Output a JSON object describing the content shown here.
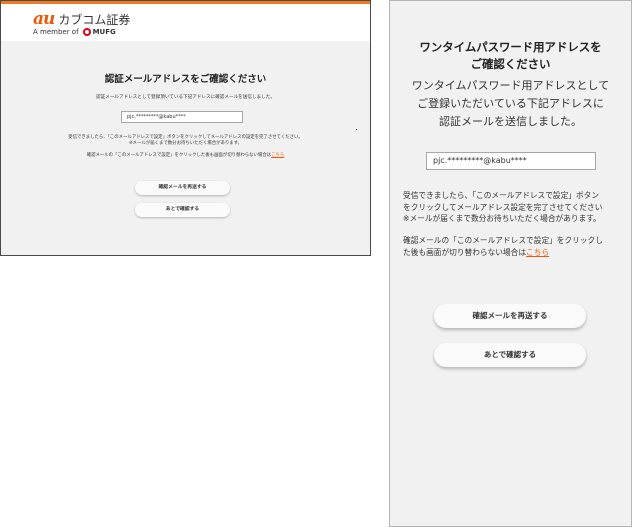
{
  "desktop": {
    "brand": {
      "au": "au",
      "name": "カブコム証券",
      "member_prefix": "A member of",
      "mufg": "MUFG"
    },
    "title": "認証メールアドレスをご確認ください",
    "description": "認証メールアドレスとして登録頂いている下記アドレスに確認メールを送信しました。",
    "email": "pjc.*********@kabu****",
    "note1": "受信できましたら、「このメールアドレスで設定」ボタンをクリックしてメールアドレスの設定を完了させてください。",
    "note2": "※メールが届くまで数分お待ちいただく場合があります。",
    "note3_prefix": "確認メールの「このメールアドレスで設定」をクリックした後も画面が切り替わらない場合は",
    "note3_link": "こちら",
    "resend_button": "確認メールを再送する",
    "later_button": "あとで確認する"
  },
  "mobile": {
    "title_line1": "ワンタイムパスワード用アドレスを",
    "title_line2": "ご確認ください",
    "desc_line1": "ワンタイムパスワード用アドレスとして",
    "desc_line2": "ご登録いただいている下記アドレスに",
    "desc_line3": "認証メールを送信しました。",
    "email": "pjc.*********@kabu****",
    "note1_line1": "受信できましたら、「このメールアドレスで設定」ボタン",
    "note1_line2": "をクリックしてメールアドレス設定を完了させてください",
    "note1_line3": "※メールが届くまで数分お待ちいただく場合があります。",
    "note2_line1": "確認メールの「このメールアドレスで設定」をクリックし",
    "note2_line2_prefix": "た後も画面が切り替わらない場合は",
    "note2_link": "こちら",
    "resend_button": "確認メールを再送する",
    "later_button": "あとで確認する"
  },
  "colors": {
    "accent": "#ea5a0c",
    "header_line": "#f07a22",
    "mufg_red": "#d9001b"
  }
}
